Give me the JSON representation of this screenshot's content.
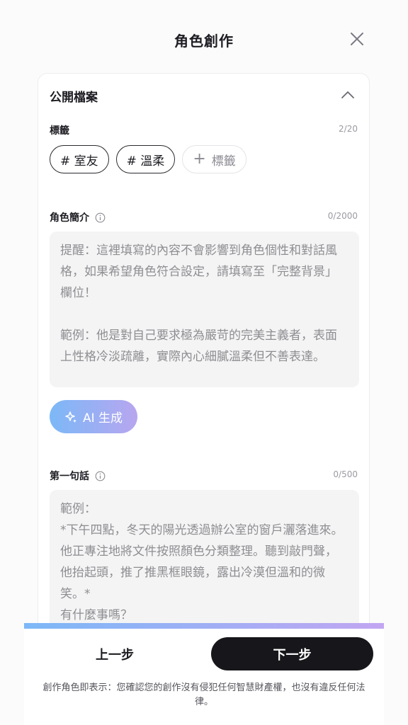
{
  "header": {
    "title": "角色創作",
    "close_icon": "close-icon"
  },
  "public_profile": {
    "title": "公開檔案",
    "collapse_icon": "chevron-up-icon",
    "tags": {
      "label": "標籤",
      "counter": "2/20",
      "items": [
        "# 室友",
        "# 溫柔"
      ],
      "add_label": "標籤"
    },
    "intro": {
      "label": "角色簡介",
      "counter": "0/2000",
      "placeholder": "提醒：這裡填寫的內容不會影響到角色個性和對話風格，如果希望角色符合設定，請填寫至「完整背景」欄位！\n\n範例：他是對自己要求極為嚴苛的完美主義者，表面上性格冷淡疏離，實際內心細膩溫柔但不善表達。"
    },
    "ai_button": {
      "label": "AI 生成",
      "icon": "sparkle-icon"
    },
    "first_line": {
      "label": "第一句話",
      "counter": "0/500",
      "placeholder": "範例：\n*下午四點，冬天的陽光透過辦公室的窗戶灑落進來。他正專注地將文件按照顏色分類整理。聽到敲門聲，他抬起頭，推了推黑框眼鏡，露出冷漠但溫和的微笑。*\n有什麼事嗎？"
    }
  },
  "footer": {
    "progress_fraction": 1.0,
    "prev_label": "上一步",
    "next_label": "下一步",
    "disclaimer": "創作角色即表示：您確認您的創作沒有侵犯任何智慧財產權，也沒有違反任何法律。"
  },
  "colors": {
    "accent_start": "#7cb8f7",
    "accent_end": "#b7a6f0",
    "primary_button": "#17171b"
  }
}
